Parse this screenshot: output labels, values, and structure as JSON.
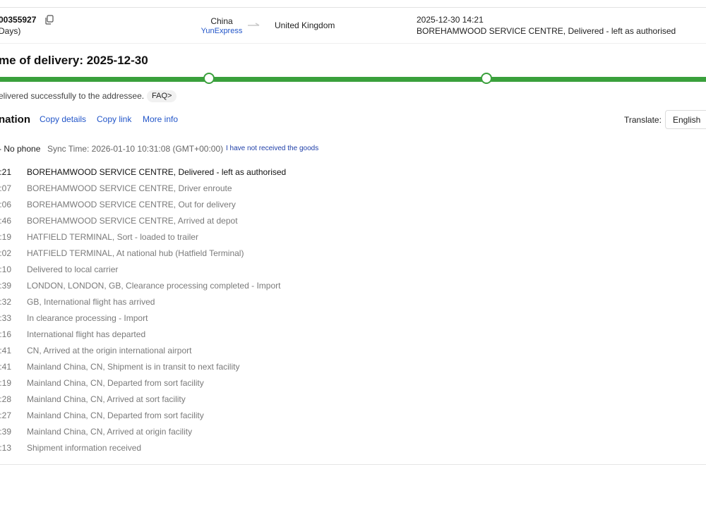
{
  "summary": {
    "tracking_fragment": "00355927",
    "days_fragment": " Days)",
    "origin_country": "China",
    "carrier": "YunExpress",
    "destination_country": "United Kingdom",
    "latest_time": "2025-12-30 14:21",
    "latest_event": "BOREHAMWOOD SERVICE CENTRE, Delivered - left as authorised"
  },
  "delivery": {
    "title": "me of delivery: 2025-12-30",
    "status_text": "elivered successfully to the addressee.",
    "faq_label": "FAQ>"
  },
  "info_bar": {
    "title": "nation",
    "copy_details": "Copy details",
    "copy_link": "Copy link",
    "more_info": "More info",
    "translate_label": "Translate:",
    "language": "English"
  },
  "sync_bar": {
    "phone": "- No phone",
    "sync_time": "Sync Time: 2026-01-10 10:31:08 (GMT+00:00)",
    "not_received": "I have not received the goods"
  },
  "colors": {
    "progress": "#3aa03c",
    "link": "#2356c9"
  },
  "events": [
    {
      "time": ":21",
      "desc": "BOREHAMWOOD SERVICE CENTRE, Delivered - left as authorised"
    },
    {
      "time": ":07",
      "desc": "BOREHAMWOOD SERVICE CENTRE, Driver enroute"
    },
    {
      "time": ":06",
      "desc": "BOREHAMWOOD SERVICE CENTRE, Out for delivery"
    },
    {
      "time": ":46",
      "desc": "BOREHAMWOOD SERVICE CENTRE, Arrived at depot"
    },
    {
      "time": ":19",
      "desc": "HATFIELD TERMINAL, Sort - loaded to trailer"
    },
    {
      "time": ":02",
      "desc": "HATFIELD TERMINAL, At national hub (Hatfield Terminal)"
    },
    {
      "time": ":10",
      "desc": "Delivered to local carrier"
    },
    {
      "time": ":39",
      "desc": "LONDON, LONDON, GB, Clearance processing completed - Import"
    },
    {
      "time": ":32",
      "desc": "GB, International flight has arrived"
    },
    {
      "time": ":33",
      "desc": "In clearance processing - Import"
    },
    {
      "time": ":16",
      "desc": "International flight has departed"
    },
    {
      "time": ":41",
      "desc": "CN, Arrived at the origin international airport"
    },
    {
      "time": ":41",
      "desc": "Mainland China, CN, Shipment is in transit to next facility"
    },
    {
      "time": ":19",
      "desc": "Mainland China, CN, Departed from sort facility"
    },
    {
      "time": ":28",
      "desc": "Mainland China, CN, Arrived at sort facility"
    },
    {
      "time": ":27",
      "desc": "Mainland China, CN, Departed from sort facility"
    },
    {
      "time": ":39",
      "desc": "Mainland China, CN, Arrived at origin facility"
    },
    {
      "time": ":13",
      "desc": "Shipment information received"
    }
  ]
}
